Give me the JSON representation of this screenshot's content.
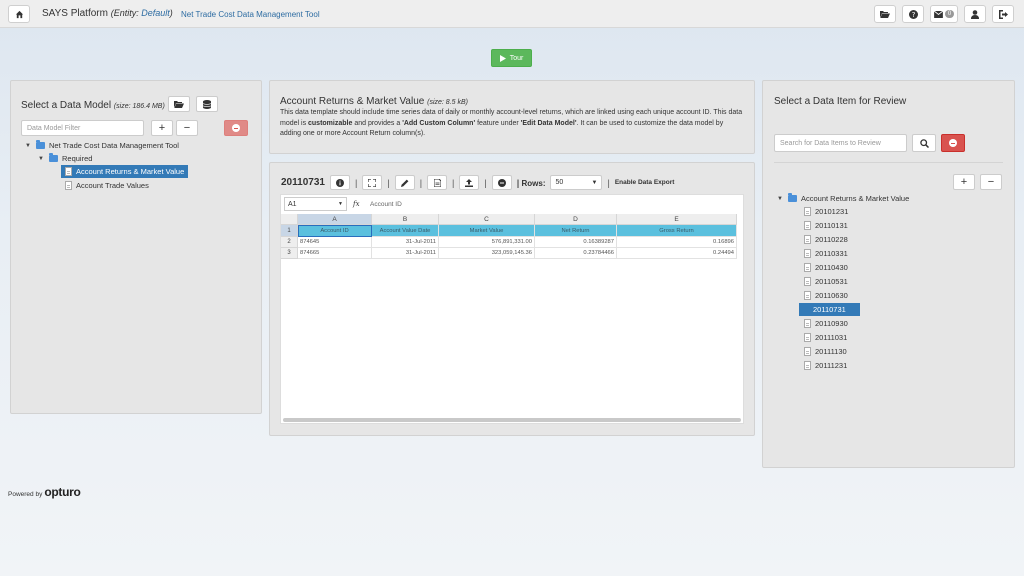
{
  "navbar": {
    "brand": "SAYS Platform",
    "entity_prefix": "(Entity: ",
    "entity_value": "Default",
    "entity_suffix": ")",
    "tool_link": "Net Trade Cost Data Management Tool",
    "mail_count": "0"
  },
  "tour": {
    "label": "Tour",
    "color": "#5cb85c"
  },
  "left_panel": {
    "title": "Select a Data Model",
    "size": "(size: 186.4 MB)",
    "filter_placeholder": "Data Model Filter",
    "add_label": "+",
    "remove_label": "−",
    "tree": {
      "root": "Net Trade Cost Data Management Tool",
      "group": "Required",
      "items": [
        "Account Returns & Market Value",
        "Account Trade Values"
      ]
    }
  },
  "info_panel": {
    "title": "Account Returns & Market Value",
    "size": "(size: 8.5 kB)",
    "desc_1": "This data template should include time series data of daily or monthly account-level returns, which are linked using each unique account ID. This data model is ",
    "desc_bold_1": "customizable",
    "desc_2": " and provides a ",
    "desc_bold_2": "'Add Custom Column'",
    "desc_3": " feature under ",
    "desc_bold_3": "'Edit Data Model'",
    "desc_4": ". It can be used to customize the data model by adding one or more Account Return column(s)."
  },
  "sheet_panel": {
    "title": "20110731",
    "rows_label": "Rows:",
    "rows_value": "50",
    "export_label": "Enable Data Export",
    "cell_ref": "A1",
    "fx": "fx",
    "formula": "Account ID",
    "columns": [
      "A",
      "B",
      "C",
      "D",
      "E"
    ],
    "row_numbers": [
      "1",
      "2",
      "3"
    ],
    "header_row": [
      "Account ID",
      "Account Value Date",
      "Market Value",
      "Net Return",
      "Gross Return"
    ],
    "rows": [
      [
        "874645",
        "31-Jul-2011",
        "576,891,331.00",
        "0.16389287",
        "0.16896"
      ],
      [
        "874665",
        "31-Jul-2011",
        "323,059,145.36",
        "0.23784466",
        "0.24494"
      ]
    ]
  },
  "right_panel": {
    "title": "Select a Data Item for Review",
    "search_placeholder": "Search for Data Items to Review",
    "add_label": "+",
    "remove_label": "−",
    "tree_root": "Account Returns & Market Value",
    "items": [
      "20101231",
      "20110131",
      "20110228",
      "20110331",
      "20110430",
      "20110531",
      "20110630",
      "20110731",
      "20110930",
      "20111031",
      "20111130",
      "20111231"
    ],
    "selected_item": "20110731"
  },
  "footer": {
    "powered_by": "Powered by",
    "logo": "opturo"
  },
  "icons": [
    "home-icon",
    "folder-open-icon",
    "question-icon",
    "envelope-icon",
    "user-icon",
    "sign-out-icon",
    "play-icon",
    "database-icon",
    "minus-circle-icon",
    "info-icon",
    "expand-icon",
    "pencil-icon",
    "file-icon",
    "upload-icon",
    "search-icon"
  ],
  "colors": {
    "accent": "#337ab7",
    "danger": "#d9534f",
    "success": "#5cb85c",
    "sheet_header": "#5bc0de"
  }
}
